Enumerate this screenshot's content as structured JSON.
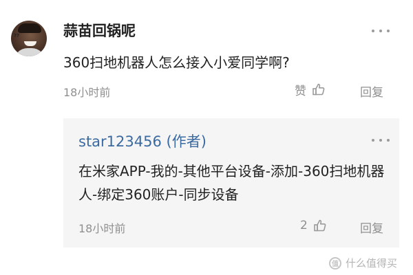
{
  "comment": {
    "avatar_tag": "??",
    "username": "蒜苗回锅呢",
    "question": "360扫地机器人怎么接入小爱同学啊?",
    "time": "18小时前",
    "like_label": "赞",
    "reply_label": "回复"
  },
  "reply": {
    "author": "star123456 (作者)",
    "text": "在米家APP-我的-其他平台设备-添加-360扫地机器人-绑定360账户-同步设备",
    "time": "18小时前",
    "like_count": "2",
    "reply_label": "回复"
  },
  "watermark": {
    "text": "什么值得买",
    "logo_glyph": "值"
  },
  "icons": {
    "more": "more-dots-icon",
    "thumbs_up": "thumbs-up-icon"
  }
}
